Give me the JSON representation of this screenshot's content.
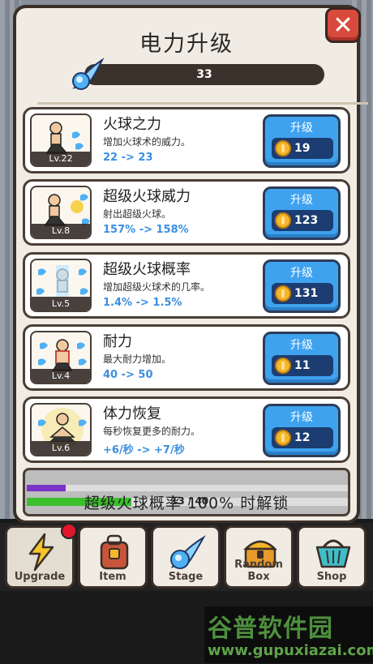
{
  "dialog": {
    "title": "电力升级",
    "close_symbol": "✕",
    "power_value": "33",
    "power_icon": "fireball-icon"
  },
  "skills": [
    {
      "name": "火球之力",
      "desc": "增加火球术的威力。",
      "stat": "22 -> 23",
      "level": "Lv.22",
      "button": "升级",
      "cost": "19"
    },
    {
      "name": "超级火球威力",
      "desc": "射出超级火球。",
      "stat": "157% -> 158%",
      "level": "Lv.8",
      "button": "升级",
      "cost": "123"
    },
    {
      "name": "超级火球概率",
      "desc": "增加超级火球术的几率。",
      "stat": "1.4% -> 1.5%",
      "level": "Lv.5",
      "button": "升级",
      "cost": "131"
    },
    {
      "name": "耐力",
      "desc": "最大耐力增加。",
      "stat": "40 -> 50",
      "level": "Lv.4",
      "button": "升级",
      "cost": "11"
    },
    {
      "name": "体力恢复",
      "desc": "每秒恢复更多的耐力。",
      "stat": "+6/秒 -> +7/秒",
      "level": "Lv.6",
      "button": "升级",
      "cost": "12"
    }
  ],
  "unlock": {
    "text": "超级火球概率 100% 时解锁",
    "progress_count": "13 / 40",
    "purple_fraction": 0.12,
    "green_fraction": 0.325
  },
  "tabs": [
    {
      "label": "Upgrade",
      "icon": "lightning-icon"
    },
    {
      "label": "Item",
      "icon": "backpack-icon"
    },
    {
      "label": "Stage",
      "icon": "fireball-icon"
    },
    {
      "label": "Random Box",
      "icon": "treasure-chest-icon"
    },
    {
      "label": "Shop",
      "icon": "basket-icon"
    }
  ],
  "colors": {
    "accent_blue": "#3fa2ef",
    "close_red": "#d84b3c",
    "stat_blue": "#3b8fe0"
  },
  "watermark": {
    "line1": "谷普软件园",
    "line2": "www.gupuxiazai.com"
  }
}
